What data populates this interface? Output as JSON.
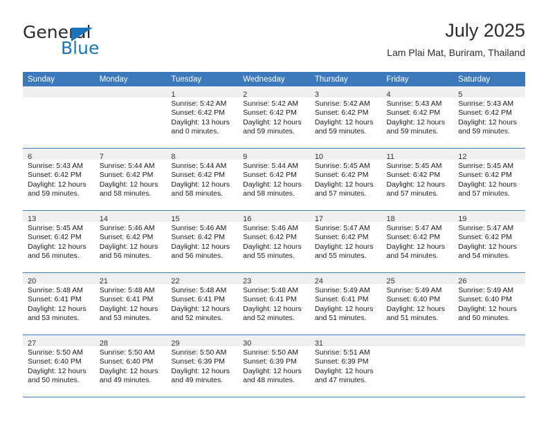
{
  "brand": {
    "name_part1": "General",
    "name_part2": "Blue",
    "logo_icon": "triangle-logo-icon"
  },
  "header": {
    "title": "July 2025",
    "location": "Lam Plai Mat, Buriram, Thailand"
  },
  "calendar": {
    "weekday_headers": [
      "Sunday",
      "Monday",
      "Tuesday",
      "Wednesday",
      "Thursday",
      "Friday",
      "Saturday"
    ],
    "accent_color": "#3b79bc",
    "daynum_band_color": "#f0f0f0",
    "weeks": [
      [
        {
          "day": "",
          "sunrise": "",
          "sunset": "",
          "daylight_line1": "",
          "daylight_line2": ""
        },
        {
          "day": "",
          "sunrise": "",
          "sunset": "",
          "daylight_line1": "",
          "daylight_line2": ""
        },
        {
          "day": "1",
          "sunrise": "Sunrise: 5:42 AM",
          "sunset": "Sunset: 6:42 PM",
          "daylight_line1": "Daylight: 13 hours",
          "daylight_line2": "and 0 minutes."
        },
        {
          "day": "2",
          "sunrise": "Sunrise: 5:42 AM",
          "sunset": "Sunset: 6:42 PM",
          "daylight_line1": "Daylight: 12 hours",
          "daylight_line2": "and 59 minutes."
        },
        {
          "day": "3",
          "sunrise": "Sunrise: 5:42 AM",
          "sunset": "Sunset: 6:42 PM",
          "daylight_line1": "Daylight: 12 hours",
          "daylight_line2": "and 59 minutes."
        },
        {
          "day": "4",
          "sunrise": "Sunrise: 5:43 AM",
          "sunset": "Sunset: 6:42 PM",
          "daylight_line1": "Daylight: 12 hours",
          "daylight_line2": "and 59 minutes."
        },
        {
          "day": "5",
          "sunrise": "Sunrise: 5:43 AM",
          "sunset": "Sunset: 6:42 PM",
          "daylight_line1": "Daylight: 12 hours",
          "daylight_line2": "and 59 minutes."
        }
      ],
      [
        {
          "day": "6",
          "sunrise": "Sunrise: 5:43 AM",
          "sunset": "Sunset: 6:42 PM",
          "daylight_line1": "Daylight: 12 hours",
          "daylight_line2": "and 59 minutes."
        },
        {
          "day": "7",
          "sunrise": "Sunrise: 5:44 AM",
          "sunset": "Sunset: 6:42 PM",
          "daylight_line1": "Daylight: 12 hours",
          "daylight_line2": "and 58 minutes."
        },
        {
          "day": "8",
          "sunrise": "Sunrise: 5:44 AM",
          "sunset": "Sunset: 6:42 PM",
          "daylight_line1": "Daylight: 12 hours",
          "daylight_line2": "and 58 minutes."
        },
        {
          "day": "9",
          "sunrise": "Sunrise: 5:44 AM",
          "sunset": "Sunset: 6:42 PM",
          "daylight_line1": "Daylight: 12 hours",
          "daylight_line2": "and 58 minutes."
        },
        {
          "day": "10",
          "sunrise": "Sunrise: 5:45 AM",
          "sunset": "Sunset: 6:42 PM",
          "daylight_line1": "Daylight: 12 hours",
          "daylight_line2": "and 57 minutes."
        },
        {
          "day": "11",
          "sunrise": "Sunrise: 5:45 AM",
          "sunset": "Sunset: 6:42 PM",
          "daylight_line1": "Daylight: 12 hours",
          "daylight_line2": "and 57 minutes."
        },
        {
          "day": "12",
          "sunrise": "Sunrise: 5:45 AM",
          "sunset": "Sunset: 6:42 PM",
          "daylight_line1": "Daylight: 12 hours",
          "daylight_line2": "and 57 minutes."
        }
      ],
      [
        {
          "day": "13",
          "sunrise": "Sunrise: 5:45 AM",
          "sunset": "Sunset: 6:42 PM",
          "daylight_line1": "Daylight: 12 hours",
          "daylight_line2": "and 56 minutes."
        },
        {
          "day": "14",
          "sunrise": "Sunrise: 5:46 AM",
          "sunset": "Sunset: 6:42 PM",
          "daylight_line1": "Daylight: 12 hours",
          "daylight_line2": "and 56 minutes."
        },
        {
          "day": "15",
          "sunrise": "Sunrise: 5:46 AM",
          "sunset": "Sunset: 6:42 PM",
          "daylight_line1": "Daylight: 12 hours",
          "daylight_line2": "and 56 minutes."
        },
        {
          "day": "16",
          "sunrise": "Sunrise: 5:46 AM",
          "sunset": "Sunset: 6:42 PM",
          "daylight_line1": "Daylight: 12 hours",
          "daylight_line2": "and 55 minutes."
        },
        {
          "day": "17",
          "sunrise": "Sunrise: 5:47 AM",
          "sunset": "Sunset: 6:42 PM",
          "daylight_line1": "Daylight: 12 hours",
          "daylight_line2": "and 55 minutes."
        },
        {
          "day": "18",
          "sunrise": "Sunrise: 5:47 AM",
          "sunset": "Sunset: 6:42 PM",
          "daylight_line1": "Daylight: 12 hours",
          "daylight_line2": "and 54 minutes."
        },
        {
          "day": "19",
          "sunrise": "Sunrise: 5:47 AM",
          "sunset": "Sunset: 6:42 PM",
          "daylight_line1": "Daylight: 12 hours",
          "daylight_line2": "and 54 minutes."
        }
      ],
      [
        {
          "day": "20",
          "sunrise": "Sunrise: 5:48 AM",
          "sunset": "Sunset: 6:41 PM",
          "daylight_line1": "Daylight: 12 hours",
          "daylight_line2": "and 53 minutes."
        },
        {
          "day": "21",
          "sunrise": "Sunrise: 5:48 AM",
          "sunset": "Sunset: 6:41 PM",
          "daylight_line1": "Daylight: 12 hours",
          "daylight_line2": "and 53 minutes."
        },
        {
          "day": "22",
          "sunrise": "Sunrise: 5:48 AM",
          "sunset": "Sunset: 6:41 PM",
          "daylight_line1": "Daylight: 12 hours",
          "daylight_line2": "and 52 minutes."
        },
        {
          "day": "23",
          "sunrise": "Sunrise: 5:48 AM",
          "sunset": "Sunset: 6:41 PM",
          "daylight_line1": "Daylight: 12 hours",
          "daylight_line2": "and 52 minutes."
        },
        {
          "day": "24",
          "sunrise": "Sunrise: 5:49 AM",
          "sunset": "Sunset: 6:41 PM",
          "daylight_line1": "Daylight: 12 hours",
          "daylight_line2": "and 51 minutes."
        },
        {
          "day": "25",
          "sunrise": "Sunrise: 5:49 AM",
          "sunset": "Sunset: 6:40 PM",
          "daylight_line1": "Daylight: 12 hours",
          "daylight_line2": "and 51 minutes."
        },
        {
          "day": "26",
          "sunrise": "Sunrise: 5:49 AM",
          "sunset": "Sunset: 6:40 PM",
          "daylight_line1": "Daylight: 12 hours",
          "daylight_line2": "and 50 minutes."
        }
      ],
      [
        {
          "day": "27",
          "sunrise": "Sunrise: 5:50 AM",
          "sunset": "Sunset: 6:40 PM",
          "daylight_line1": "Daylight: 12 hours",
          "daylight_line2": "and 50 minutes."
        },
        {
          "day": "28",
          "sunrise": "Sunrise: 5:50 AM",
          "sunset": "Sunset: 6:40 PM",
          "daylight_line1": "Daylight: 12 hours",
          "daylight_line2": "and 49 minutes."
        },
        {
          "day": "29",
          "sunrise": "Sunrise: 5:50 AM",
          "sunset": "Sunset: 6:39 PM",
          "daylight_line1": "Daylight: 12 hours",
          "daylight_line2": "and 49 minutes."
        },
        {
          "day": "30",
          "sunrise": "Sunrise: 5:50 AM",
          "sunset": "Sunset: 6:39 PM",
          "daylight_line1": "Daylight: 12 hours",
          "daylight_line2": "and 48 minutes."
        },
        {
          "day": "31",
          "sunrise": "Sunrise: 5:51 AM",
          "sunset": "Sunset: 6:39 PM",
          "daylight_line1": "Daylight: 12 hours",
          "daylight_line2": "and 47 minutes."
        },
        {
          "day": "",
          "sunrise": "",
          "sunset": "",
          "daylight_line1": "",
          "daylight_line2": ""
        },
        {
          "day": "",
          "sunrise": "",
          "sunset": "",
          "daylight_line1": "",
          "daylight_line2": ""
        }
      ]
    ]
  }
}
